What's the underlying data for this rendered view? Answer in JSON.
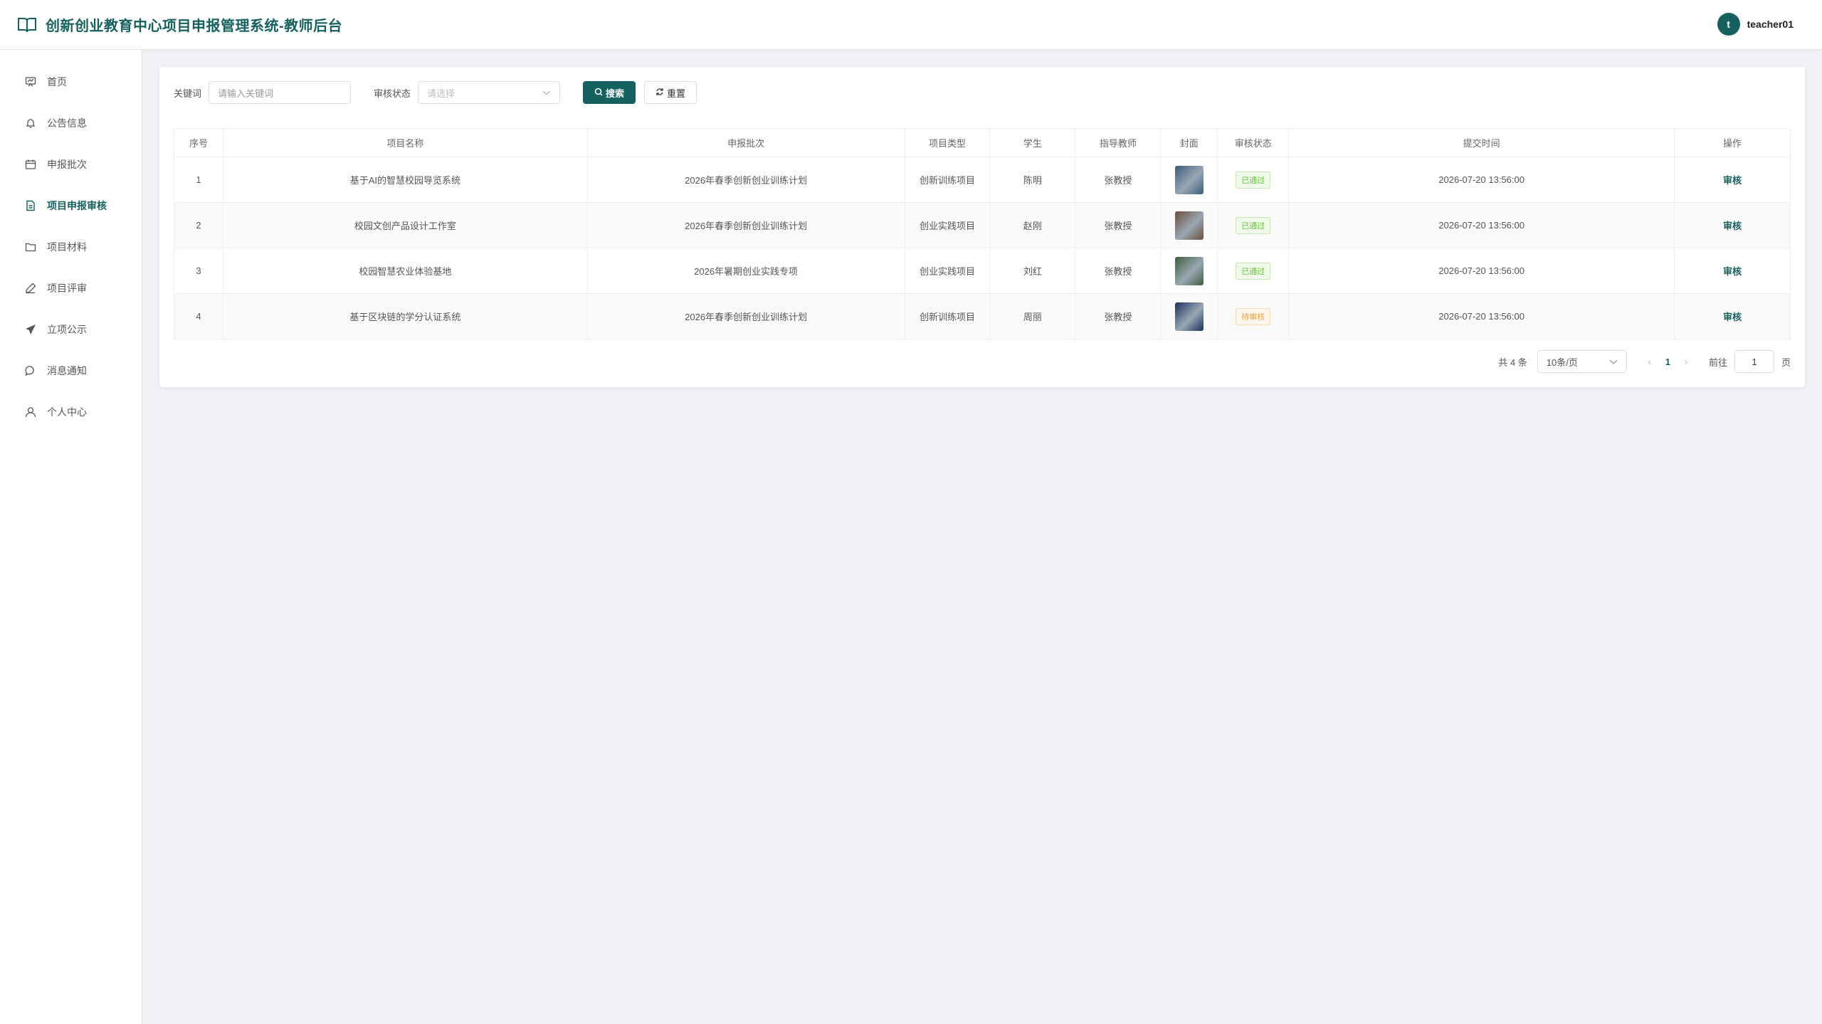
{
  "header": {
    "title": "创新创业教育中心项目申报管理系统-教师后台",
    "user": {
      "avatar_letter": "t",
      "name": "teacher01"
    }
  },
  "sidebar": {
    "items": [
      {
        "label": "首页",
        "icon": "dashboard-icon"
      },
      {
        "label": "公告信息",
        "icon": "bell-icon"
      },
      {
        "label": "申报批次",
        "icon": "calendar-icon"
      },
      {
        "label": "项目申报审核",
        "icon": "document-icon",
        "active": true
      },
      {
        "label": "项目材料",
        "icon": "folder-icon"
      },
      {
        "label": "项目评审",
        "icon": "pen-icon"
      },
      {
        "label": "立项公示",
        "icon": "send-icon"
      },
      {
        "label": "消息通知",
        "icon": "chat-icon"
      },
      {
        "label": "个人中心",
        "icon": "user-icon"
      }
    ]
  },
  "filters": {
    "keyword_label": "关键词",
    "keyword_placeholder": "请输入关键词",
    "status_label": "审核状态",
    "status_placeholder": "请选择",
    "search_label": "搜索",
    "reset_label": "重置"
  },
  "table": {
    "columns": [
      "序号",
      "项目名称",
      "申报批次",
      "项目类型",
      "学生",
      "指导教师",
      "封面",
      "审核状态",
      "提交时间",
      "操作"
    ],
    "rows": [
      {
        "no": "1",
        "name": "基于AI的智慧校园导览系统",
        "batch": "2026年春季创新创业训练计划",
        "type": "创新训练项目",
        "student": "陈明",
        "teacher": "张教授",
        "status": "已通过",
        "status_kind": "ok",
        "time": "2026-07-20 13:56:00",
        "action": "审核",
        "cover_color": "#3b5b7a"
      },
      {
        "no": "2",
        "name": "校园文创产品设计工作室",
        "batch": "2026年春季创新创业训练计划",
        "type": "创业实践项目",
        "student": "赵刚",
        "teacher": "张教授",
        "status": "已通过",
        "status_kind": "ok",
        "time": "2026-07-20 13:56:00",
        "action": "审核",
        "cover_color": "#6b4e3a"
      },
      {
        "no": "3",
        "name": "校园智慧农业体验基地",
        "batch": "2026年暑期创业实践专项",
        "type": "创业实践项目",
        "student": "刘红",
        "teacher": "张教授",
        "status": "已通过",
        "status_kind": "ok",
        "time": "2026-07-20 13:56:00",
        "action": "审核",
        "cover_color": "#3f5e3a"
      },
      {
        "no": "4",
        "name": "基于区块链的学分认证系统",
        "batch": "2026年春季创新创业训练计划",
        "type": "创新训练项目",
        "student": "周丽",
        "teacher": "张教授",
        "status": "待审核",
        "status_kind": "wait",
        "time": "2026-07-20 13:56:00",
        "action": "审核",
        "cover_color": "#1a2f5a"
      }
    ]
  },
  "pagination": {
    "total": "共 4 条",
    "page_size": "10条/页",
    "current": "1",
    "goto_label": "前往",
    "goto_value": "1",
    "page_suffix": "页"
  },
  "colors": {
    "accent": "#15615f",
    "ok": "#67c23a",
    "wait": "#e6a23c"
  }
}
